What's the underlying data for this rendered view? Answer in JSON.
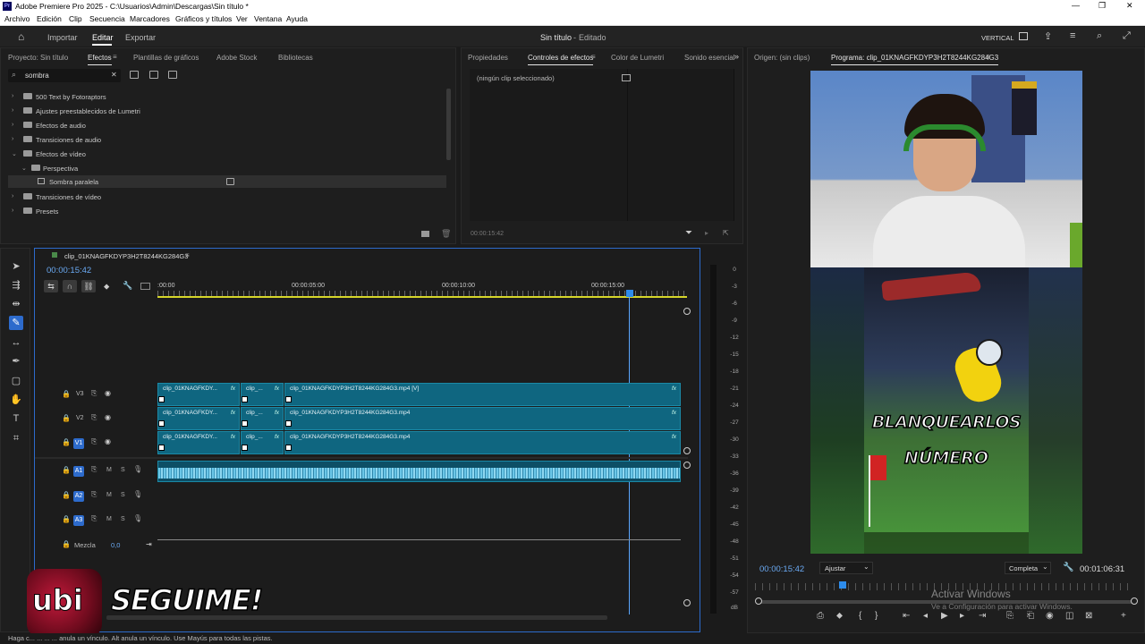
{
  "title_bar": {
    "title": "Adobe Premiere Pro 2025 - C:\\Usuarios\\Admin\\Descargas\\Sin título *"
  },
  "menu": [
    "Archivo",
    "Edición",
    "Clip",
    "Secuencia",
    "Marcadores",
    "Gráficos y títulos",
    "Ver",
    "Ventana",
    "Ayuda"
  ],
  "workspace": {
    "tabs": [
      "Importar",
      "Editar",
      "Exportar"
    ],
    "active_tab": "Editar",
    "project_title": "Sin título",
    "project_state": "Editado",
    "layout_label": "VERTICAL"
  },
  "left_panel": {
    "tabs": [
      "Proyecto: Sin título",
      "Efectos",
      "Plantillas de gráficos",
      "Adobe Stock",
      "Bibliotecas"
    ],
    "active_tab": "Efectos",
    "search_value": "sombra",
    "tree": [
      {
        "label": "500 Text by Fotoraptors",
        "level": 0,
        "expanded": false
      },
      {
        "label": "Ajustes preestablecidos de Lumetri",
        "level": 0,
        "expanded": false
      },
      {
        "label": "Efectos de audio",
        "level": 0,
        "expanded": false
      },
      {
        "label": "Transiciones de audio",
        "level": 0,
        "expanded": false
      },
      {
        "label": "Efectos de vídeo",
        "level": 0,
        "expanded": true
      },
      {
        "label": "Perspectiva",
        "level": 1,
        "expanded": true
      },
      {
        "label": "Sombra paralela",
        "level": 2,
        "selected": true
      },
      {
        "label": "Transiciones de vídeo",
        "level": 0,
        "expanded": false
      },
      {
        "label": "Presets",
        "level": 0,
        "expanded": false
      }
    ]
  },
  "effect_controls": {
    "tabs": [
      "Propiedades",
      "Controles de efectos",
      "Color de Lumetri",
      "Sonido esencial"
    ],
    "active_tab": "Controles de efectos",
    "empty_text": "(ningún clip seleccionado)",
    "timecode": "00:00:15:42"
  },
  "program_monitor": {
    "tabs": [
      "Origen: (sin clips)",
      "Programa: clip_01KNAGFKDYP3H2T8244KG284G3"
    ],
    "caption_top": "BLANQUEARLOS",
    "caption_bottom": "NÚMERO",
    "timecode": "00:00:15:42",
    "fit": "Ajustar",
    "quality": "Completa",
    "duration": "00:01:06:31",
    "playhead_fraction": 0.23
  },
  "timeline": {
    "sequence_tab": "clip_01KNAGFKDYP3H2T8244KG284G3",
    "timecode": "00:00:15:42",
    "ruler": [
      ":00:00",
      "00:00:05:00",
      "00:00:10:00",
      "00:00:15:00"
    ],
    "video_tracks": [
      {
        "name": "V3",
        "clips": [
          {
            "label": "clip_01KNAGFKDY...",
            "fx": "fx"
          },
          {
            "label": "clip_...",
            "fx": "fx"
          },
          {
            "label": "clip_01KNAGFKDYP3H2T8244KG284G3.mp4 [V]",
            "fx": "fx"
          }
        ]
      },
      {
        "name": "V2",
        "clips": [
          {
            "label": "clip_01KNAGFKDY...",
            "fx": "fx"
          },
          {
            "label": "clip_...",
            "fx": "fx"
          },
          {
            "label": "clip_01KNAGFKDYP3H2T8244KG284G3.mp4",
            "fx": "fx"
          }
        ]
      },
      {
        "name": "V1",
        "clips": [
          {
            "label": "clip_01KNAGFKDY...",
            "fx": "fx"
          },
          {
            "label": "clip_...",
            "fx": "fx"
          },
          {
            "label": "clip_01KNAGFKDYP3H2T8244KG284G3.mp4",
            "fx": "fx"
          }
        ]
      }
    ],
    "audio_tracks": [
      "A1",
      "A2",
      "A3"
    ],
    "mix_label": "Mezcla",
    "mix_value": "0,0",
    "track_toggles": {
      "mute": "M",
      "solo": "S"
    }
  },
  "meter_scale": [
    "0",
    "-3",
    "-6",
    "-9",
    "-12",
    "-15",
    "-18",
    "-21",
    "-24",
    "-27",
    "-30",
    "-33",
    "-36",
    "-39",
    "-42",
    "-45",
    "-48",
    "-51",
    "-54",
    "-57",
    "dB"
  ],
  "overlay": {
    "logo": "ubi",
    "cta": "SEGUIME!"
  },
  "watermark": {
    "line1": "Activar Windows",
    "line2": "Ve a Configuración para activar Windows."
  },
  "status_text": "Haga c... ... ... ... anula un vínculo. Alt anula un vínculo. Use Mayús para todas las pistas.",
  "colors": {
    "accent": "#2d8ceb",
    "clip": "#0f6680",
    "audio": "#6cc7e8",
    "timecode": "#6aa9f2"
  }
}
